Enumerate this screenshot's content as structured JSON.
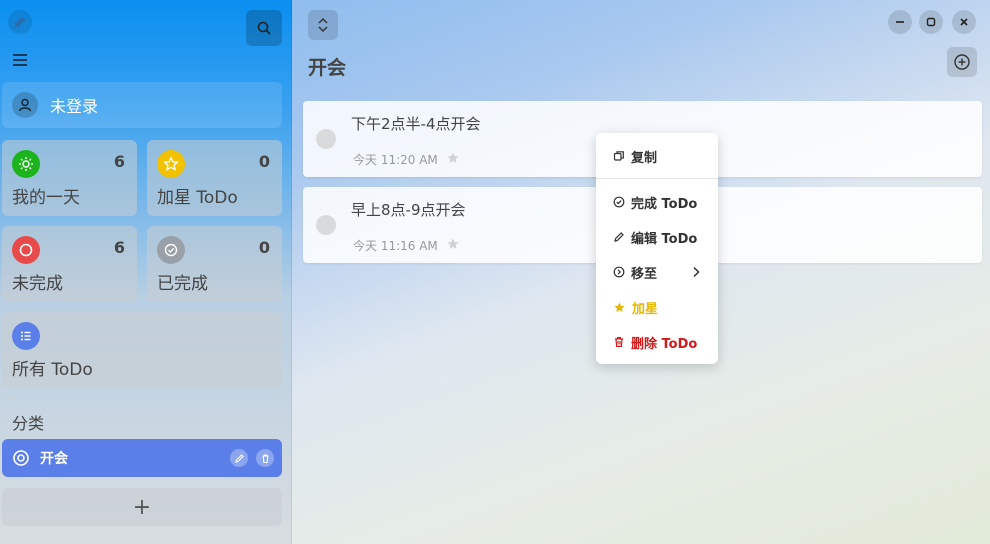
{
  "sidebar": {
    "user": {
      "name": "未登录"
    },
    "stats": [
      {
        "label": "我的一天",
        "count": "6",
        "color": "#1db31d",
        "icon": "sun-icon"
      },
      {
        "label": "加星 ToDo",
        "count": "0",
        "color": "#f2c200",
        "icon": "star-icon"
      },
      {
        "label": "未完成",
        "count": "6",
        "color": "#e84a4a",
        "icon": "circle-icon"
      },
      {
        "label": "已完成",
        "count": "0",
        "color": "#9aa0a8",
        "icon": "check-circle-icon"
      },
      {
        "label": "所有 ToDo",
        "color": "#5b7fe8",
        "icon": "list-icon"
      }
    ],
    "categories_heading": "分类",
    "categories": [
      {
        "label": "开会"
      }
    ],
    "add_category_label": "+"
  },
  "main": {
    "title": "开会",
    "todos": [
      {
        "title": "下午2点半-4点开会",
        "time": "今天 11:20 AM"
      },
      {
        "title": "早上8点-9点开会",
        "time": "今天 11:16 AM"
      }
    ]
  },
  "context_menu": {
    "items": [
      {
        "label": "复制",
        "icon": "copy-icon"
      },
      {
        "label": "完成 ToDo",
        "icon": "check-circle-icon"
      },
      {
        "label": "编辑 ToDo",
        "icon": "pencil-icon"
      },
      {
        "label": "移至",
        "icon": "arrow-circle-icon"
      },
      {
        "label": "加星",
        "icon": "star-icon",
        "color": "#e6b800"
      },
      {
        "label": "删除 ToDo",
        "icon": "trash-icon",
        "color": "#d11a1a"
      }
    ]
  },
  "colors": {
    "accent": "#5b7fe8",
    "sidebar_top": "#0a8ff0"
  }
}
